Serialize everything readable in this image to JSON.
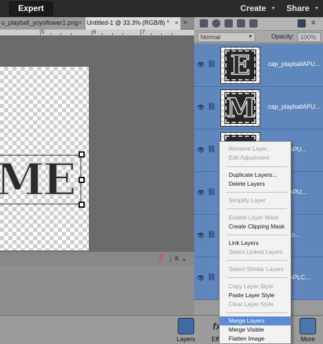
{
  "header": {
    "mode_label": "Expert",
    "create_label": "Create",
    "share_label": "Share"
  },
  "tabs": [
    {
      "label": "o_playball_yoyoflower1.png",
      "close": "×"
    },
    {
      "label": "Untitled-1 @ 33.3% (RGB/8) *",
      "close": "×"
    }
  ],
  "tabs_overflow": "»",
  "ruler": {
    "marks": [
      "5",
      "6",
      "7"
    ]
  },
  "canvas": {
    "text": "ME"
  },
  "layers_panel": {
    "blend_mode": "Normal",
    "opacity_label": "Opacity:",
    "opacity_value": "100%",
    "layers": [
      {
        "letter": "E",
        "name": "cap_playballAPU..."
      },
      {
        "letter": "M",
        "name": "cap_playballAPU..."
      },
      {
        "letter": "",
        "name": "playballAPU..."
      },
      {
        "letter": "",
        "name": "playballAPU..."
      },
      {
        "letter": "",
        "name": "APLC-e.p..."
      },
      {
        "letter": "",
        "name": "playballAPLC..."
      }
    ]
  },
  "context_menu": {
    "items": [
      {
        "label": "Rename Layer...",
        "enabled": false
      },
      {
        "label": "Edit Adjustment",
        "enabled": false
      },
      {
        "label": "Duplicate Layers...",
        "enabled": true
      },
      {
        "label": "Delete Layers",
        "enabled": true
      },
      {
        "label": "Simplify Layer",
        "enabled": false
      },
      {
        "label": "Enable Layer Mask",
        "enabled": false
      },
      {
        "label": "Create Clipping Mask",
        "enabled": true
      },
      {
        "label": "Link Layers",
        "enabled": true
      },
      {
        "label": "Select Linked Layers",
        "enabled": false
      },
      {
        "label": "Select Similar Layers",
        "enabled": false
      },
      {
        "label": "Copy Layer Style",
        "enabled": false
      },
      {
        "label": "Paste Layer Style",
        "enabled": true
      },
      {
        "label": "Clear Layer Style",
        "enabled": false
      },
      {
        "label": "Merge Layers",
        "enabled": true,
        "highlighted": true
      },
      {
        "label": "Merge Visible",
        "enabled": true
      },
      {
        "label": "Flatten Image",
        "enabled": true
      }
    ]
  },
  "bottom_bar": {
    "layers_label": "Layers",
    "effects_label": "Effe",
    "more_label": "More"
  }
}
